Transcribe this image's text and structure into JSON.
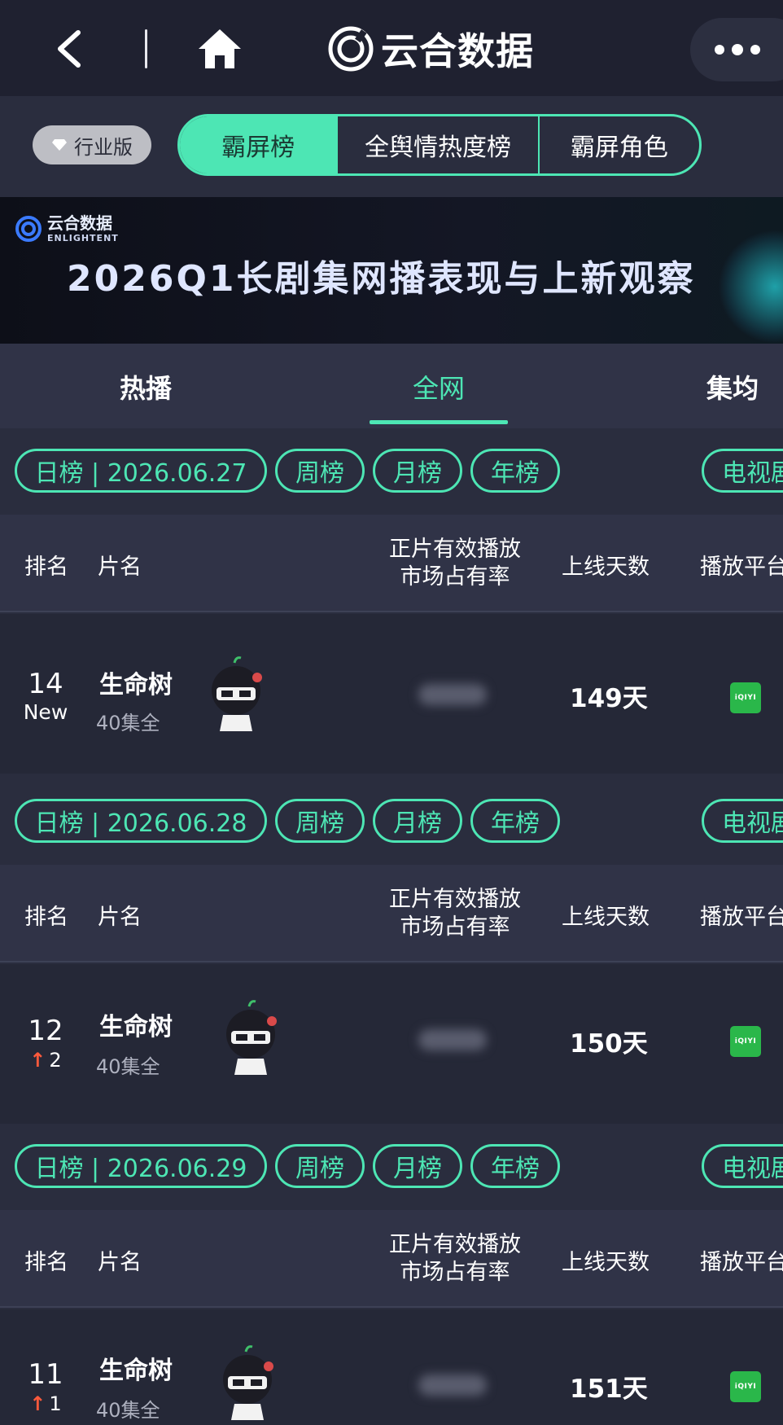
{
  "header": {
    "back_icon": "chevron-left-icon",
    "home_icon": "home-icon",
    "brand_title": "云合数据",
    "more_icon": "more-dots-icon"
  },
  "nav": {
    "edition_label": "行业版",
    "segments": [
      "霸屏榜",
      "全舆情热度榜",
      "霸屏角色"
    ],
    "active_segment": "霸屏榜"
  },
  "banner": {
    "logo_text": "云合数据",
    "logo_sub": "ENLIGHTENT",
    "title": "2026Q1长剧集网播表现与上新观察"
  },
  "categories": {
    "items": [
      "热播",
      "全网",
      "集均"
    ],
    "active": "全网"
  },
  "table_headers": {
    "rank": "排名",
    "name": "片名",
    "share_line1": "正片有效播放",
    "share_line2": "市场占有率",
    "days": "上线天数",
    "platform": "播放平台"
  },
  "filter_labels": {
    "week": "周榜",
    "month": "月榜",
    "year": "年榜",
    "tv": "电视剧"
  },
  "blocks": [
    {
      "date_pill": "日榜 | 2026.06.27",
      "row": {
        "rank": "14",
        "change": "New",
        "change_dir": "new",
        "title": "生命树",
        "episodes": "40集全",
        "days": "149天",
        "platform": "iQIYI"
      }
    },
    {
      "date_pill": "日榜 | 2026.06.28",
      "row": {
        "rank": "12",
        "change": "2",
        "change_dir": "up",
        "title": "生命树",
        "episodes": "40集全",
        "days": "150天",
        "platform": "iQIYI"
      }
    },
    {
      "date_pill": "日榜 | 2026.06.29",
      "row": {
        "rank": "11",
        "change": "1",
        "change_dir": "up",
        "title": "生命树",
        "episodes": "40集全",
        "days": "151天",
        "platform": "iQIYI"
      }
    }
  ],
  "colors": {
    "accent": "#4de6b4",
    "rank_up": "#ff5a3c",
    "iqiyi": "#2ab74a"
  }
}
